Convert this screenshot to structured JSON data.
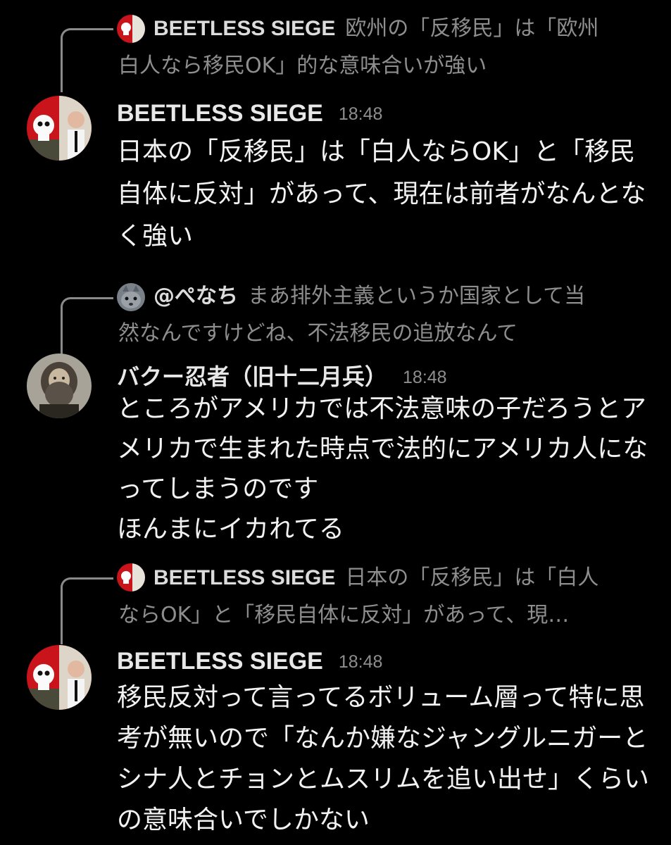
{
  "messages": [
    {
      "reply": {
        "author": "BEETLESS SIEGE",
        "text_line1": "欧州の「反移民」は「欧州",
        "text_line2": "白人なら移民OK」的な意味合いが強い",
        "avatar_icon": "skull-flag-avatar-icon"
      },
      "author": "BEETLESS SIEGE",
      "time": "18:48",
      "body": "日本の「反移民」は「白人ならOK」と「移民自体に反対」があって、現在は前者がなんとなく強い",
      "avatar_icon": "skull-flag-avatar-icon"
    },
    {
      "reply": {
        "author": "@ぺなち",
        "text_line1": "まあ排外主義というか国家として当",
        "text_line2": "然なんですけどね、不法移民の追放なんて",
        "avatar_icon": "cat-avatar-icon"
      },
      "author": "バクー忍者（旧十二月兵）",
      "time": "18:48",
      "body": "ところがアメリカでは不法意味の子だろうとアメリカで生まれた時点で法的にアメリカ人になってしまうのです\nほんまにイカれてる",
      "avatar_icon": "bearded-man-avatar-icon"
    },
    {
      "reply": {
        "author": "BEETLESS SIEGE",
        "text_line1": "日本の「反移民」は「白人",
        "text_line2": "ならOK」と「移民自体に反対」があって、現…",
        "avatar_icon": "skull-flag-avatar-icon"
      },
      "author": "BEETLESS SIEGE",
      "time": "18:48",
      "body": "移民反対って言ってるボリューム層って特に思考が無いので「なんか嫌なジャングルニガーとシナ人とチョンとムスリムを追い出せ」くらいの意味合いでしかない",
      "avatar_icon": "skull-flag-avatar-icon"
    }
  ],
  "colors": {
    "background": "#000000",
    "text_primary": "#f2f2f2",
    "text_secondary": "#8e8e8e",
    "reply_line": "#8a8a8a"
  }
}
